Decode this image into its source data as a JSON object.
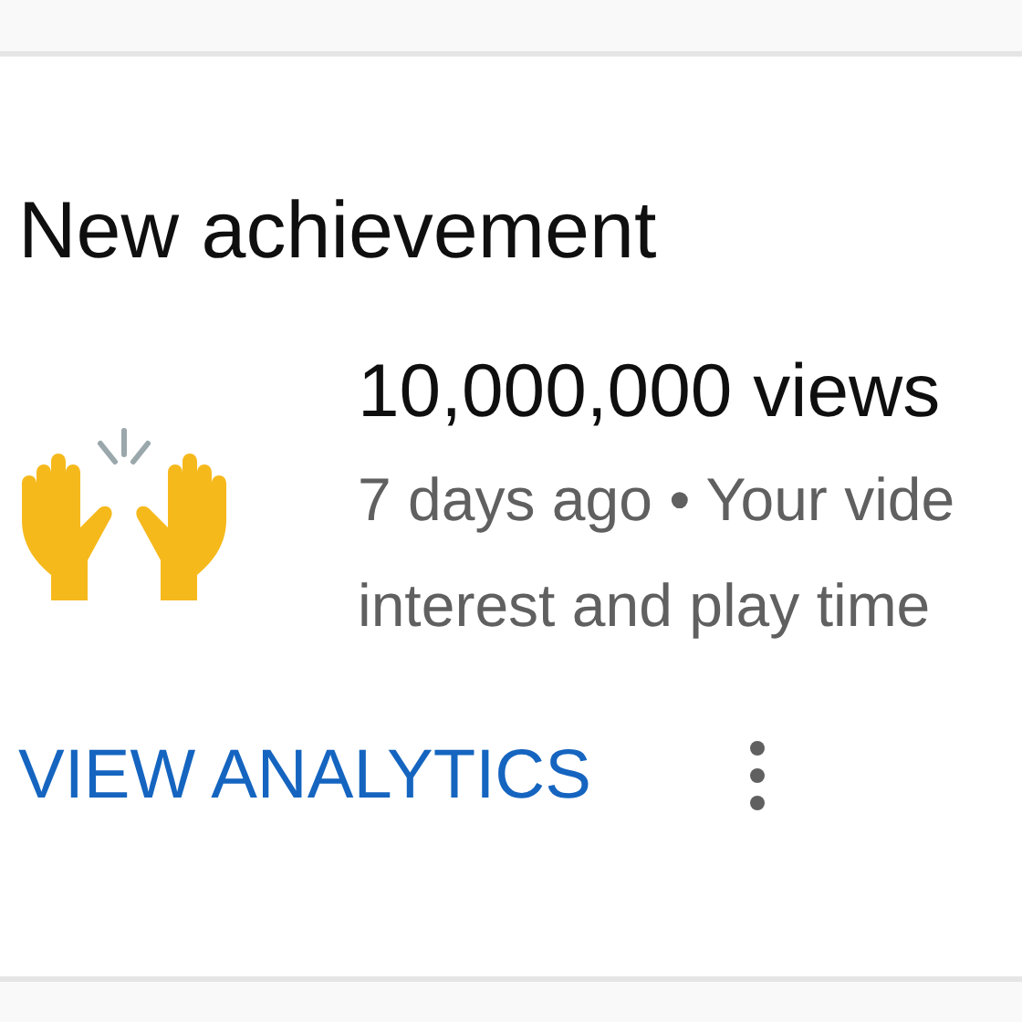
{
  "card": {
    "title": "New achievement",
    "achievement": {
      "headline": "10,000,000 views",
      "meta": "7 days ago • Your vide",
      "detail": "interest and play time"
    },
    "action": "VIEW ANALYTICS"
  }
}
